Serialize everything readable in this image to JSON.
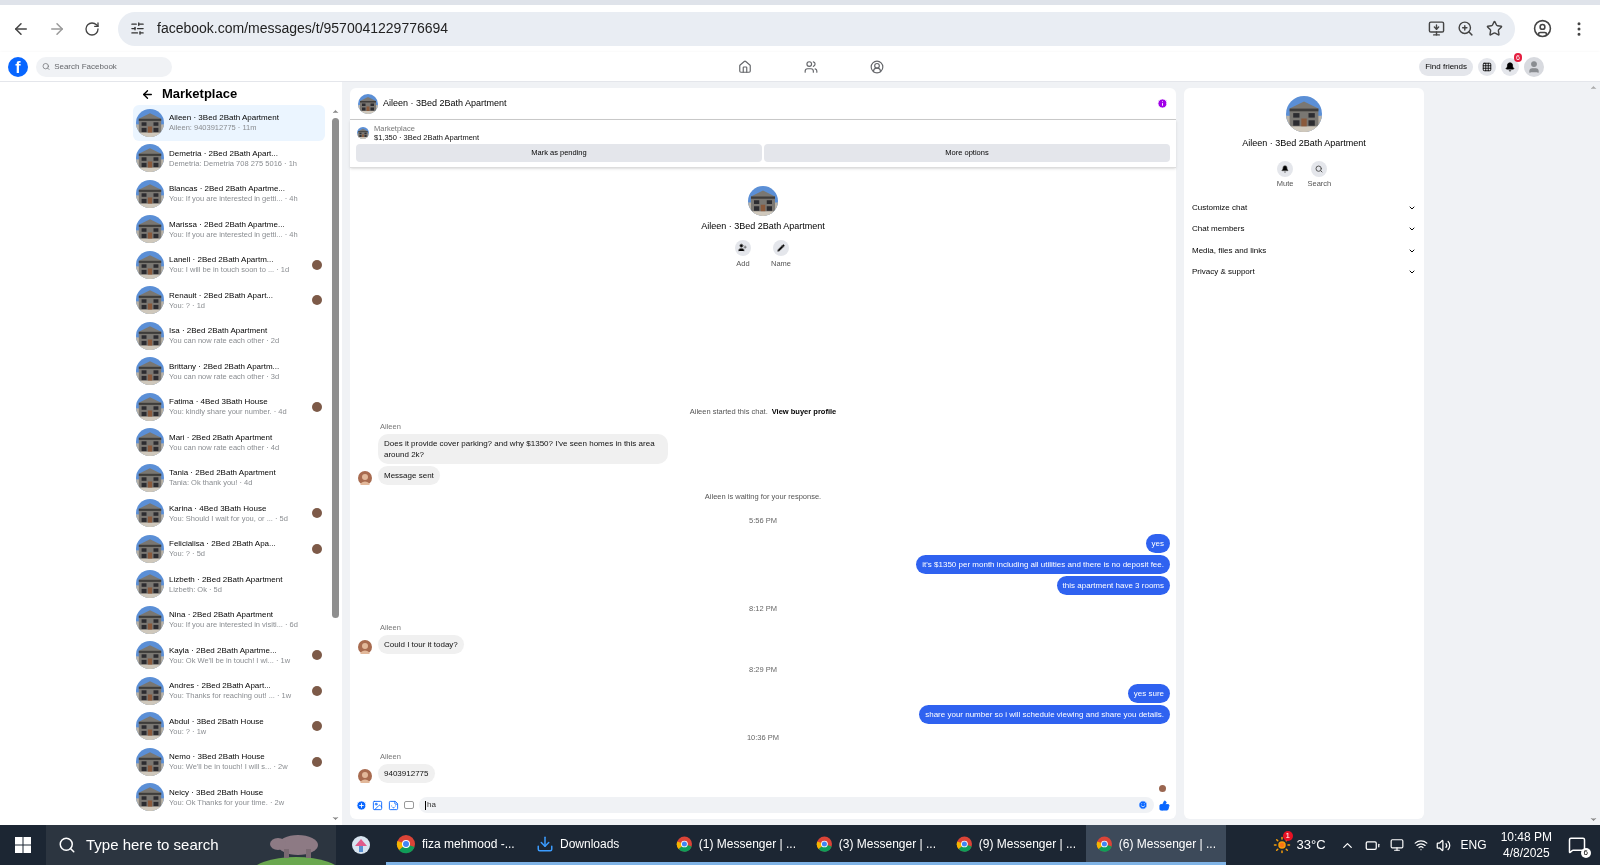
{
  "browser": {
    "url": "facebook.com/messages/t/9570041229776694"
  },
  "topbar": {
    "logo": "f",
    "search_placeholder": "Search Facebook",
    "find_friends": "Find friends",
    "notifications": "6"
  },
  "sidebar": {
    "title": "Marketplace",
    "conversations": [
      {
        "title": "Aileen · 3Bed 2Bath Apartment",
        "preview": "Aileen: 9403912775 · 11m",
        "selected": true,
        "seen": false
      },
      {
        "title": "Demetria · 2Bed 2Bath Apart...",
        "preview": "Demetria: Demetria 708 275 5016 · 1h",
        "selected": false,
        "seen": false
      },
      {
        "title": "Blancas · 2Bed 2Bath Apartme...",
        "preview": "You: If you are interested in getti... · 4h",
        "selected": false,
        "seen": false
      },
      {
        "title": "Marissa · 2Bed 2Bath Apartme...",
        "preview": "You: If you are interested in getti... · 4h",
        "selected": false,
        "seen": false
      },
      {
        "title": "Lanell · 2Bed 2Bath Apartm...",
        "preview": "You: I will be in touch soon to ... · 1d",
        "selected": false,
        "seen": true
      },
      {
        "title": "Renault · 2Bed 2Bath Apart...",
        "preview": "You: ? · 1d",
        "selected": false,
        "seen": true
      },
      {
        "title": "Isa · 2Bed 2Bath Apartment",
        "preview": "You can now rate each other · 2d",
        "selected": false,
        "seen": false
      },
      {
        "title": "Brittany · 2Bed 2Bath Apartm...",
        "preview": "You can now rate each other · 3d",
        "selected": false,
        "seen": false
      },
      {
        "title": "Fatima · 4Bed 3Bath House",
        "preview": "You: kindly share your number. · 4d",
        "selected": false,
        "seen": true
      },
      {
        "title": "Mari · 2Bed 2Bath Apartment",
        "preview": "You can now rate each other · 4d",
        "selected": false,
        "seen": false
      },
      {
        "title": "Tania · 2Bed 2Bath Apartment",
        "preview": "Tania: Ok thank you! · 4d",
        "selected": false,
        "seen": false
      },
      {
        "title": "Karina · 4Bed 3Bath House",
        "preview": "You: Should I wait for you, or ... · 5d",
        "selected": false,
        "seen": true
      },
      {
        "title": "Felicialisa · 2Bed 2Bath Apa...",
        "preview": "You: ? · 5d",
        "selected": false,
        "seen": true
      },
      {
        "title": "Lizbeth · 2Bed 2Bath Apartment",
        "preview": "Lizbeth: Ok · 5d",
        "selected": false,
        "seen": false
      },
      {
        "title": "Nina · 2Bed 2Bath Apartment",
        "preview": "You: If you are interested in visiti... · 6d",
        "selected": false,
        "seen": false
      },
      {
        "title": "Kayla · 2Bed 2Bath Apartme...",
        "preview": "You: Ok We'll be in touch! I wi... · 1w",
        "selected": false,
        "seen": true
      },
      {
        "title": "Andres · 2Bed 2Bath Apart...",
        "preview": "You: Thanks for reaching out! ... · 1w",
        "selected": false,
        "seen": true
      },
      {
        "title": "Abdul · 3Bed 2Bath House",
        "preview": "You: ? · 1w",
        "selected": false,
        "seen": true
      },
      {
        "title": "Nemo · 3Bed 2Bath House",
        "preview": "You: We'll be in touch! I will s... · 2w",
        "selected": false,
        "seen": true
      },
      {
        "title": "Neicy · 3Bed 2Bath House",
        "preview": "You: Ok Thanks for your time. · 2w",
        "selected": false,
        "seen": false
      }
    ]
  },
  "chat": {
    "title": "Aileen · 3Bed 2Bath Apartment",
    "listing": {
      "label": "Marketplace",
      "text": "$1,350 · 3Bed 2Bath Apartment"
    },
    "actions": [
      "Mark as pending",
      "More options"
    ],
    "profile": {
      "name": "Aileen · 3Bed 2Bath Apartment",
      "buttons": [
        "Add",
        "Name"
      ]
    },
    "messages": [
      {
        "kind": "system",
        "text": "Aileen started this chat.",
        "link": "View buyer profile"
      },
      {
        "kind": "incoming",
        "sender": "Aileen",
        "bubbles": [
          "Does it provide cover parking? and why $1350? I've seen homes in this area around 2k?",
          "Message sent"
        ]
      },
      {
        "kind": "system",
        "text": "Aileen is waiting for your response."
      },
      {
        "kind": "time",
        "text": "5:56 PM"
      },
      {
        "kind": "outgoing",
        "bubbles": [
          "yes",
          "it's $1350 per month including all utilities and there is no deposit fee.",
          "this apartment have 3 rooms"
        ]
      },
      {
        "kind": "time",
        "text": "8:12 PM"
      },
      {
        "kind": "incoming",
        "sender": "Aileen",
        "bubbles": [
          "Could I tour it today?"
        ]
      },
      {
        "kind": "time",
        "text": "8:29 PM"
      },
      {
        "kind": "outgoing",
        "bubbles": [
          "yes sure",
          "share your number so i will schedule viewing and share you details."
        ]
      },
      {
        "kind": "time",
        "text": "10:36 PM"
      },
      {
        "kind": "incoming",
        "sender": "Aileen",
        "bubbles": [
          "9403912775"
        ]
      }
    ],
    "composer": {
      "value": "ha"
    }
  },
  "details": {
    "name": "Aileen · 3Bed 2Bath Apartment",
    "buttons": [
      "Mute",
      "Search"
    ],
    "sections": [
      {
        "label": "Customize chat",
        "expanded": false
      },
      {
        "label": "Chat members",
        "expanded": false
      },
      {
        "label": "Media, files and links",
        "expanded": false
      },
      {
        "label": "Privacy & support",
        "expanded": false
      }
    ]
  },
  "taskbar": {
    "search_placeholder": "Type here to search",
    "apps": [
      {
        "label": "fiza mehmood -...",
        "kind": "chrome",
        "selected": false
      },
      {
        "label": "Downloads",
        "kind": "download",
        "selected": false
      },
      {
        "label": "(1) Messenger | ...",
        "kind": "chrome",
        "selected": false
      },
      {
        "label": "(3) Messenger | ...",
        "kind": "chrome",
        "selected": false
      },
      {
        "label": "(9) Messenger | ...",
        "kind": "chrome",
        "selected": false
      },
      {
        "label": "(6) Messenger | ...",
        "kind": "chrome",
        "selected": true
      }
    ],
    "weather_badge": "1",
    "temperature": "33°C",
    "language": "ENG",
    "time": "10:48 PM",
    "date": "4/8/2025",
    "notifications": "6"
  }
}
